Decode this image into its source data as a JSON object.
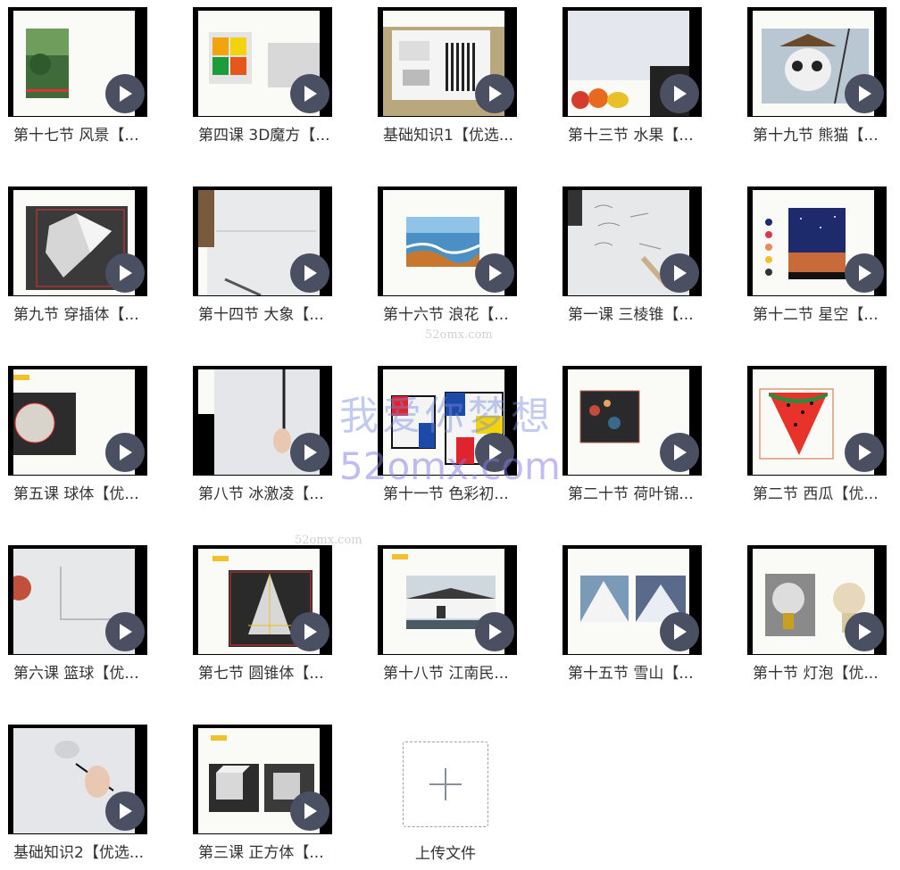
{
  "videos": [
    {
      "title": "第十七节 风景【...",
      "icon": "landscape-thumbnail"
    },
    {
      "title": "第四课 3D魔方【...",
      "icon": "rubiks-cube-thumbnail"
    },
    {
      "title": "基础知识1【优选...",
      "icon": "art-supplies-thumbnail"
    },
    {
      "title": "第十三节  水果【...",
      "icon": "fruit-thumbnail"
    },
    {
      "title": "第十九节 熊猫【...",
      "icon": "panda-thumbnail"
    },
    {
      "title": "第九节 穿插体【...",
      "icon": "intersecting-solid-thumbnail"
    },
    {
      "title": "第十四节 大象【...",
      "icon": "elephant-thumbnail"
    },
    {
      "title": "第十六节 浪花【...",
      "icon": "waves-thumbnail"
    },
    {
      "title": "第一课 三棱锥【...",
      "icon": "pyramid-sketch-thumbnail"
    },
    {
      "title": "第十二节 星空【...",
      "icon": "starry-sky-thumbnail"
    },
    {
      "title": "第五课 球体【优...",
      "icon": "sphere-thumbnail"
    },
    {
      "title": "第八节 冰激凌【...",
      "icon": "ice-cream-drawing-thumbnail"
    },
    {
      "title": "第十一节 色彩初...",
      "icon": "color-blocks-thumbnail"
    },
    {
      "title": "第二十节 荷叶锦...",
      "icon": "lotus-koi-thumbnail"
    },
    {
      "title": "第二节 西瓜【优...",
      "icon": "watermelon-thumbnail"
    },
    {
      "title": "第六课 篮球【优...",
      "icon": "basketball-thumbnail"
    },
    {
      "title": "第七节 圆锥体【...",
      "icon": "cone-thumbnail"
    },
    {
      "title": "第十八节 江南民...",
      "icon": "jiangnan-house-thumbnail"
    },
    {
      "title": "第十五节 雪山【...",
      "icon": "snow-mountain-thumbnail"
    },
    {
      "title": "第十节 灯泡【优...",
      "icon": "light-bulb-thumbnail"
    },
    {
      "title": "基础知识2【优选...",
      "icon": "hand-drawing-thumbnail"
    },
    {
      "title": "第三课 正方体【...",
      "icon": "cube-thumbnail"
    }
  ],
  "upload": {
    "label": "上传文件",
    "icon": "plus-icon"
  },
  "watermark": {
    "text": "我爱你梦想",
    "url": "52omx.com",
    "small": "52omx.com"
  },
  "colors": {
    "play_button": "#4a5062",
    "thumbnail_border": "#000000",
    "text": "#333333"
  }
}
